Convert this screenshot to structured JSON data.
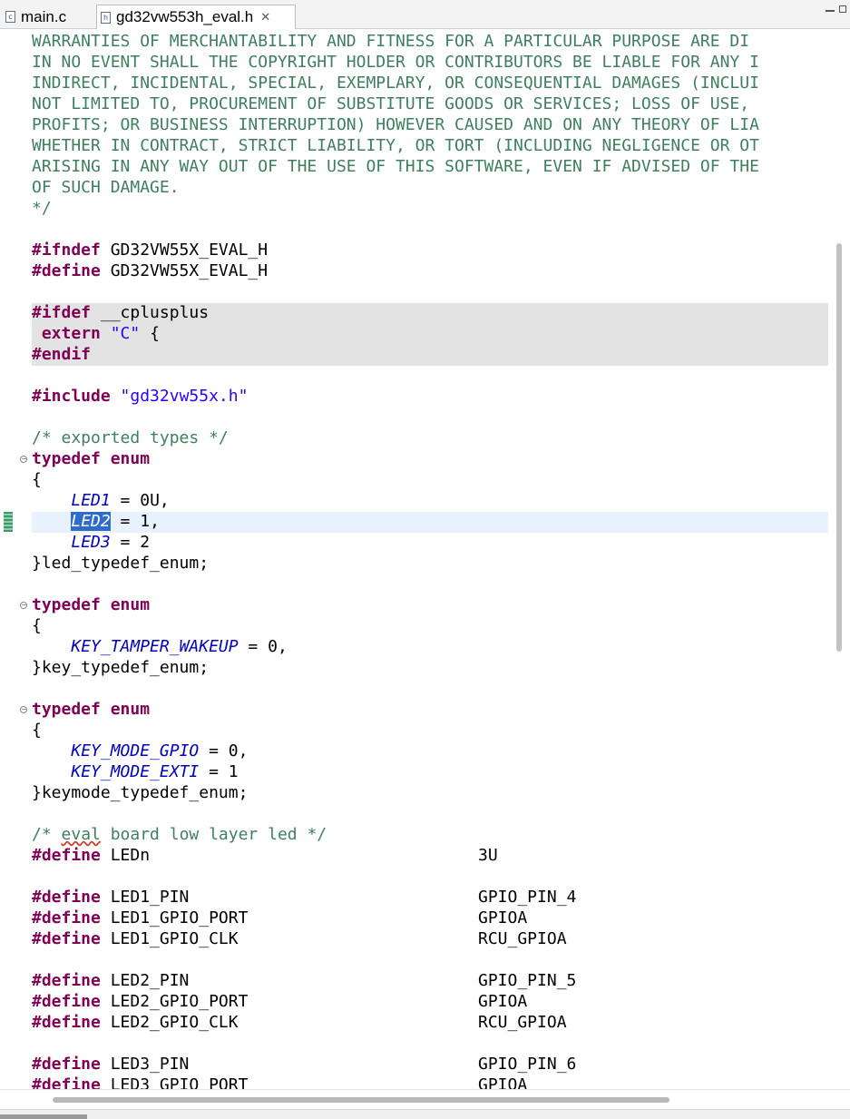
{
  "tabs": [
    {
      "label": "main.c",
      "icon": "c-source-file-icon",
      "active": false
    },
    {
      "label": "gd32vw553h_eval.h",
      "icon": "header-file-icon",
      "active": true
    }
  ],
  "colors": {
    "comment": "#3f7f5f",
    "keyword": "#7f0055",
    "string": "#2a00ff",
    "enumerator": "#0000c0",
    "selection": "#2f6cc9",
    "current_line": "#e8f2fe",
    "inactive_block": "#e3e3e3"
  },
  "code": {
    "license": [
      "WARRANTIES OF MERCHANTABILITY AND FITNESS FOR A PARTICULAR PURPOSE ARE DI",
      "IN NO EVENT SHALL THE COPYRIGHT HOLDER OR CONTRIBUTORS BE LIABLE FOR ANY I",
      "INDIRECT, INCIDENTAL, SPECIAL, EXEMPLARY, OR CONSEQUENTIAL DAMAGES (INCLUI",
      "NOT LIMITED TO, PROCUREMENT OF SUBSTITUTE GOODS OR SERVICES; LOSS OF USE,",
      "PROFITS; OR BUSINESS INTERRUPTION) HOWEVER CAUSED AND ON ANY THEORY OF LIA",
      "WHETHER IN CONTRACT, STRICT LIABILITY, OR TORT (INCLUDING NEGLIGENCE OR OT",
      "ARISING IN ANY WAY OUT OF THE USE OF THIS SOFTWARE, EVEN IF ADVISED OF THE",
      "OF SUCH DAMAGE.",
      "*/"
    ],
    "kw_ifndef": "#ifndef",
    "kw_define": "#define",
    "kw_ifdef": "#ifdef",
    "kw_endif": "#endif",
    "kw_include": "#include",
    "kw_extern": "extern",
    "kw_typedef": "typedef",
    "kw_enum": "enum",
    "guard_macro": "GD32VW55X_EVAL_H",
    "cplusplus": "__cplusplus",
    "extern_c_string": "\"C\"",
    "open_brace": "{",
    "include_file": "\"gd32vw55x.h\"",
    "comment_exported_types": "/* exported types */",
    "led_enum": {
      "items": [
        {
          "name": "LED1",
          "value": "0U,"
        },
        {
          "name": "LED2",
          "value": "1,"
        },
        {
          "name": "LED3",
          "value": "2"
        }
      ],
      "close": "}led_typedef_enum;"
    },
    "key_enum": {
      "items": [
        {
          "name": "KEY_TAMPER_WAKEUP",
          "value": "0,"
        }
      ],
      "close": "}key_typedef_enum;"
    },
    "keymode_enum": {
      "items": [
        {
          "name": "KEY_MODE_GPIO",
          "value": "0,"
        },
        {
          "name": "KEY_MODE_EXTI",
          "value": "1"
        }
      ],
      "close": "}keymode_typedef_enum;"
    },
    "comment_led_pre": "/* ",
    "comment_led_word": "eval",
    "comment_led_post": " board low layer led */",
    "defines": [
      {
        "name": "LEDn",
        "value": "3U"
      },
      {
        "name": "LED1_PIN",
        "value": "GPIO_PIN_4"
      },
      {
        "name": "LED1_GPIO_PORT",
        "value": "GPIOA"
      },
      {
        "name": "LED1_GPIO_CLK",
        "value": "RCU_GPIOA"
      },
      {
        "name": "LED2_PIN",
        "value": "GPIO_PIN_5"
      },
      {
        "name": "LED2_GPIO_PORT",
        "value": "GPIOA"
      },
      {
        "name": "LED2_GPIO_CLK",
        "value": "RCU_GPIOA"
      },
      {
        "name": "LED3_PIN",
        "value": "GPIO_PIN_6"
      },
      {
        "name": "LED3_GPIO_PORT",
        "value": "GPIOA"
      }
    ]
  }
}
